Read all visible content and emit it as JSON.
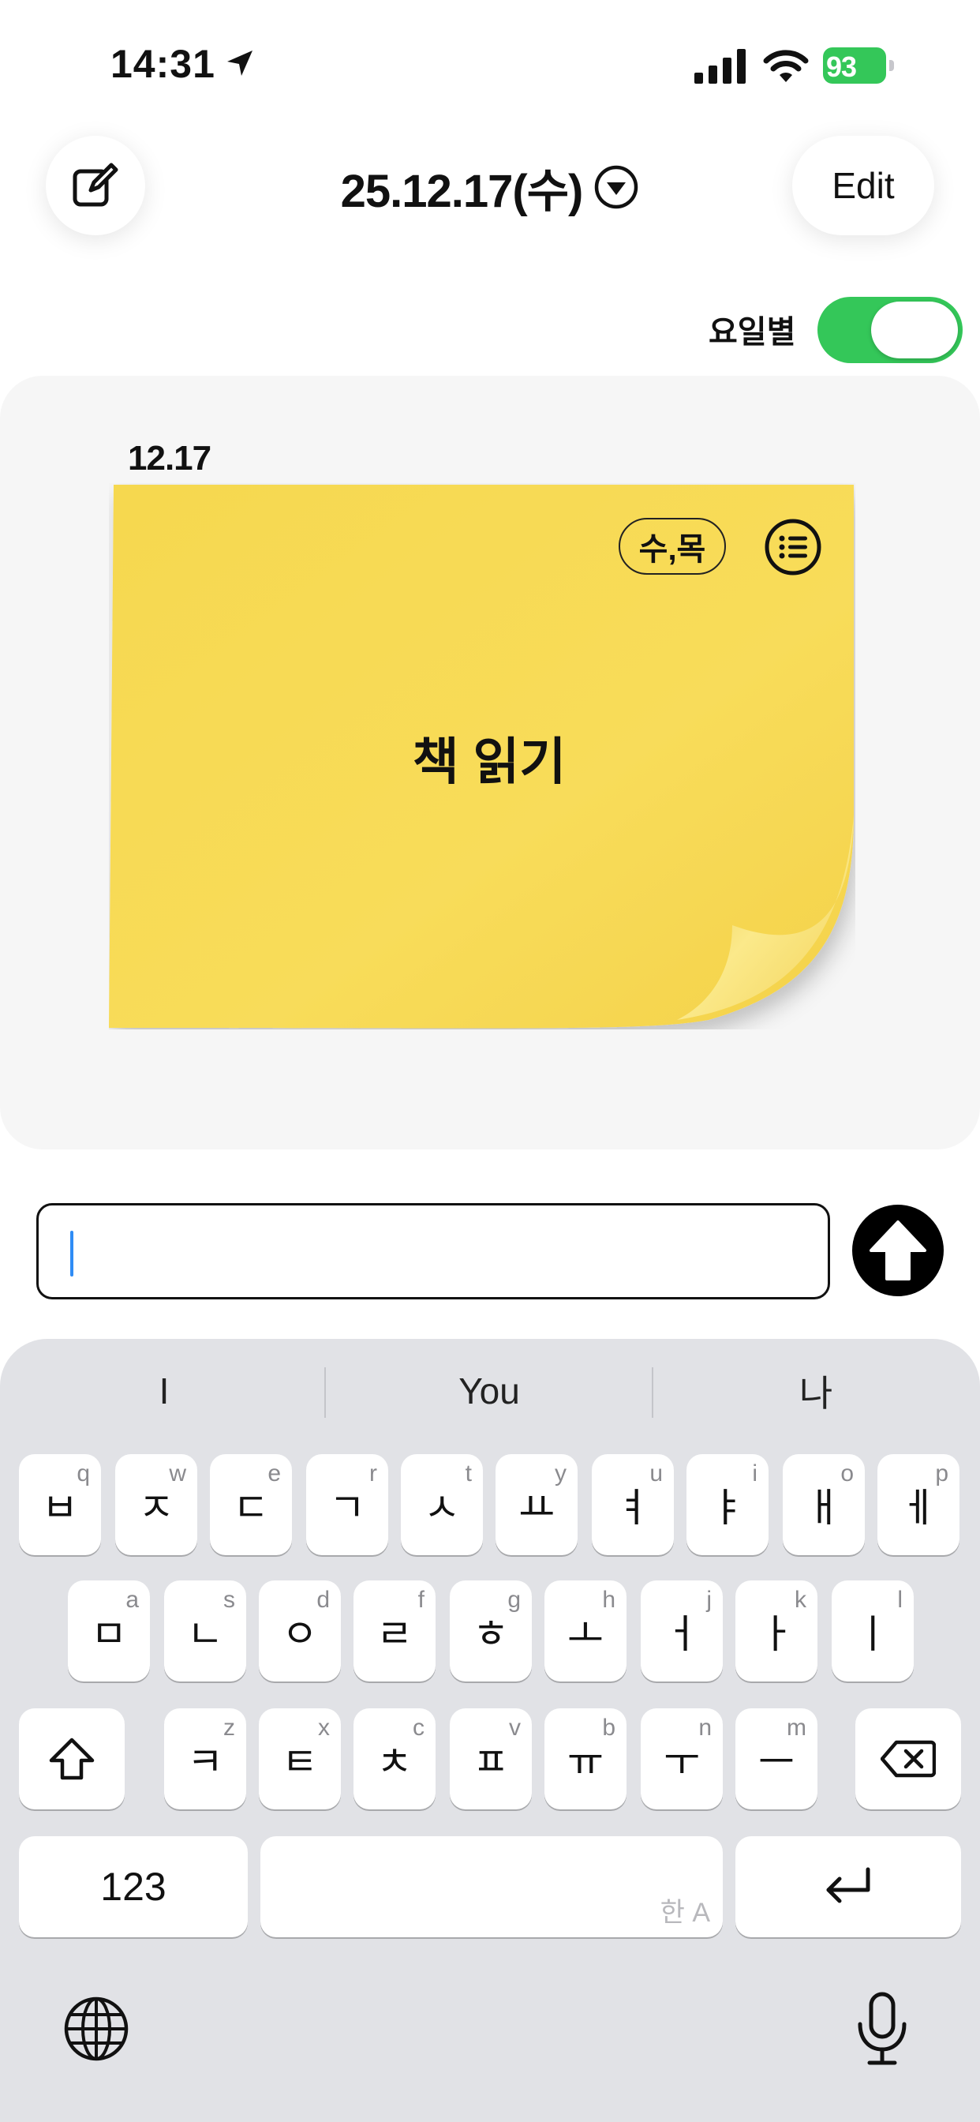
{
  "status_bar": {
    "time": "14:31",
    "battery_percent": "93",
    "icons": [
      "location-arrow-icon",
      "cellular-signal-icon",
      "wifi-icon",
      "battery-charging-icon"
    ]
  },
  "header": {
    "date": "25.12.17(수)",
    "edit_label": "Edit",
    "compose_icon": "compose-icon",
    "dropdown_icon": "chevron-down-circle-icon"
  },
  "toggle": {
    "label": "요일별",
    "on": true
  },
  "note": {
    "date_label": "12.17",
    "day_badge": "수,목",
    "text": "책 읽기",
    "color": "#f8dc5a",
    "menu_icon": "list-icon"
  },
  "input": {
    "value": "",
    "send_icon": "arrow-up-icon"
  },
  "keyboard": {
    "suggestions": [
      "I",
      "You",
      "나"
    ],
    "row1": [
      {
        "main": "ㅂ",
        "hint": "q"
      },
      {
        "main": "ㅈ",
        "hint": "w"
      },
      {
        "main": "ㄷ",
        "hint": "e"
      },
      {
        "main": "ㄱ",
        "hint": "r"
      },
      {
        "main": "ㅅ",
        "hint": "t"
      },
      {
        "main": "ㅛ",
        "hint": "y"
      },
      {
        "main": "ㅕ",
        "hint": "u"
      },
      {
        "main": "ㅑ",
        "hint": "i"
      },
      {
        "main": "ㅐ",
        "hint": "o"
      },
      {
        "main": "ㅔ",
        "hint": "p"
      }
    ],
    "row2": [
      {
        "main": "ㅁ",
        "hint": "a"
      },
      {
        "main": "ㄴ",
        "hint": "s"
      },
      {
        "main": "ㅇ",
        "hint": "d"
      },
      {
        "main": "ㄹ",
        "hint": "f"
      },
      {
        "main": "ㅎ",
        "hint": "g"
      },
      {
        "main": "ㅗ",
        "hint": "h"
      },
      {
        "main": "ㅓ",
        "hint": "j"
      },
      {
        "main": "ㅏ",
        "hint": "k"
      },
      {
        "main": "ㅣ",
        "hint": "l"
      }
    ],
    "row3": [
      {
        "main": "ㅋ",
        "hint": "z"
      },
      {
        "main": "ㅌ",
        "hint": "x"
      },
      {
        "main": "ㅊ",
        "hint": "c"
      },
      {
        "main": "ㅍ",
        "hint": "v"
      },
      {
        "main": "ㅠ",
        "hint": "b"
      },
      {
        "main": "ㅜ",
        "hint": "n"
      },
      {
        "main": "ㅡ",
        "hint": "m"
      }
    ],
    "numbers_label": "123",
    "space_lang": "한 A",
    "shift_icon": "shift-icon",
    "delete_icon": "backspace-icon",
    "return_icon": "return-icon",
    "globe_icon": "globe-icon",
    "mic_icon": "microphone-icon"
  }
}
